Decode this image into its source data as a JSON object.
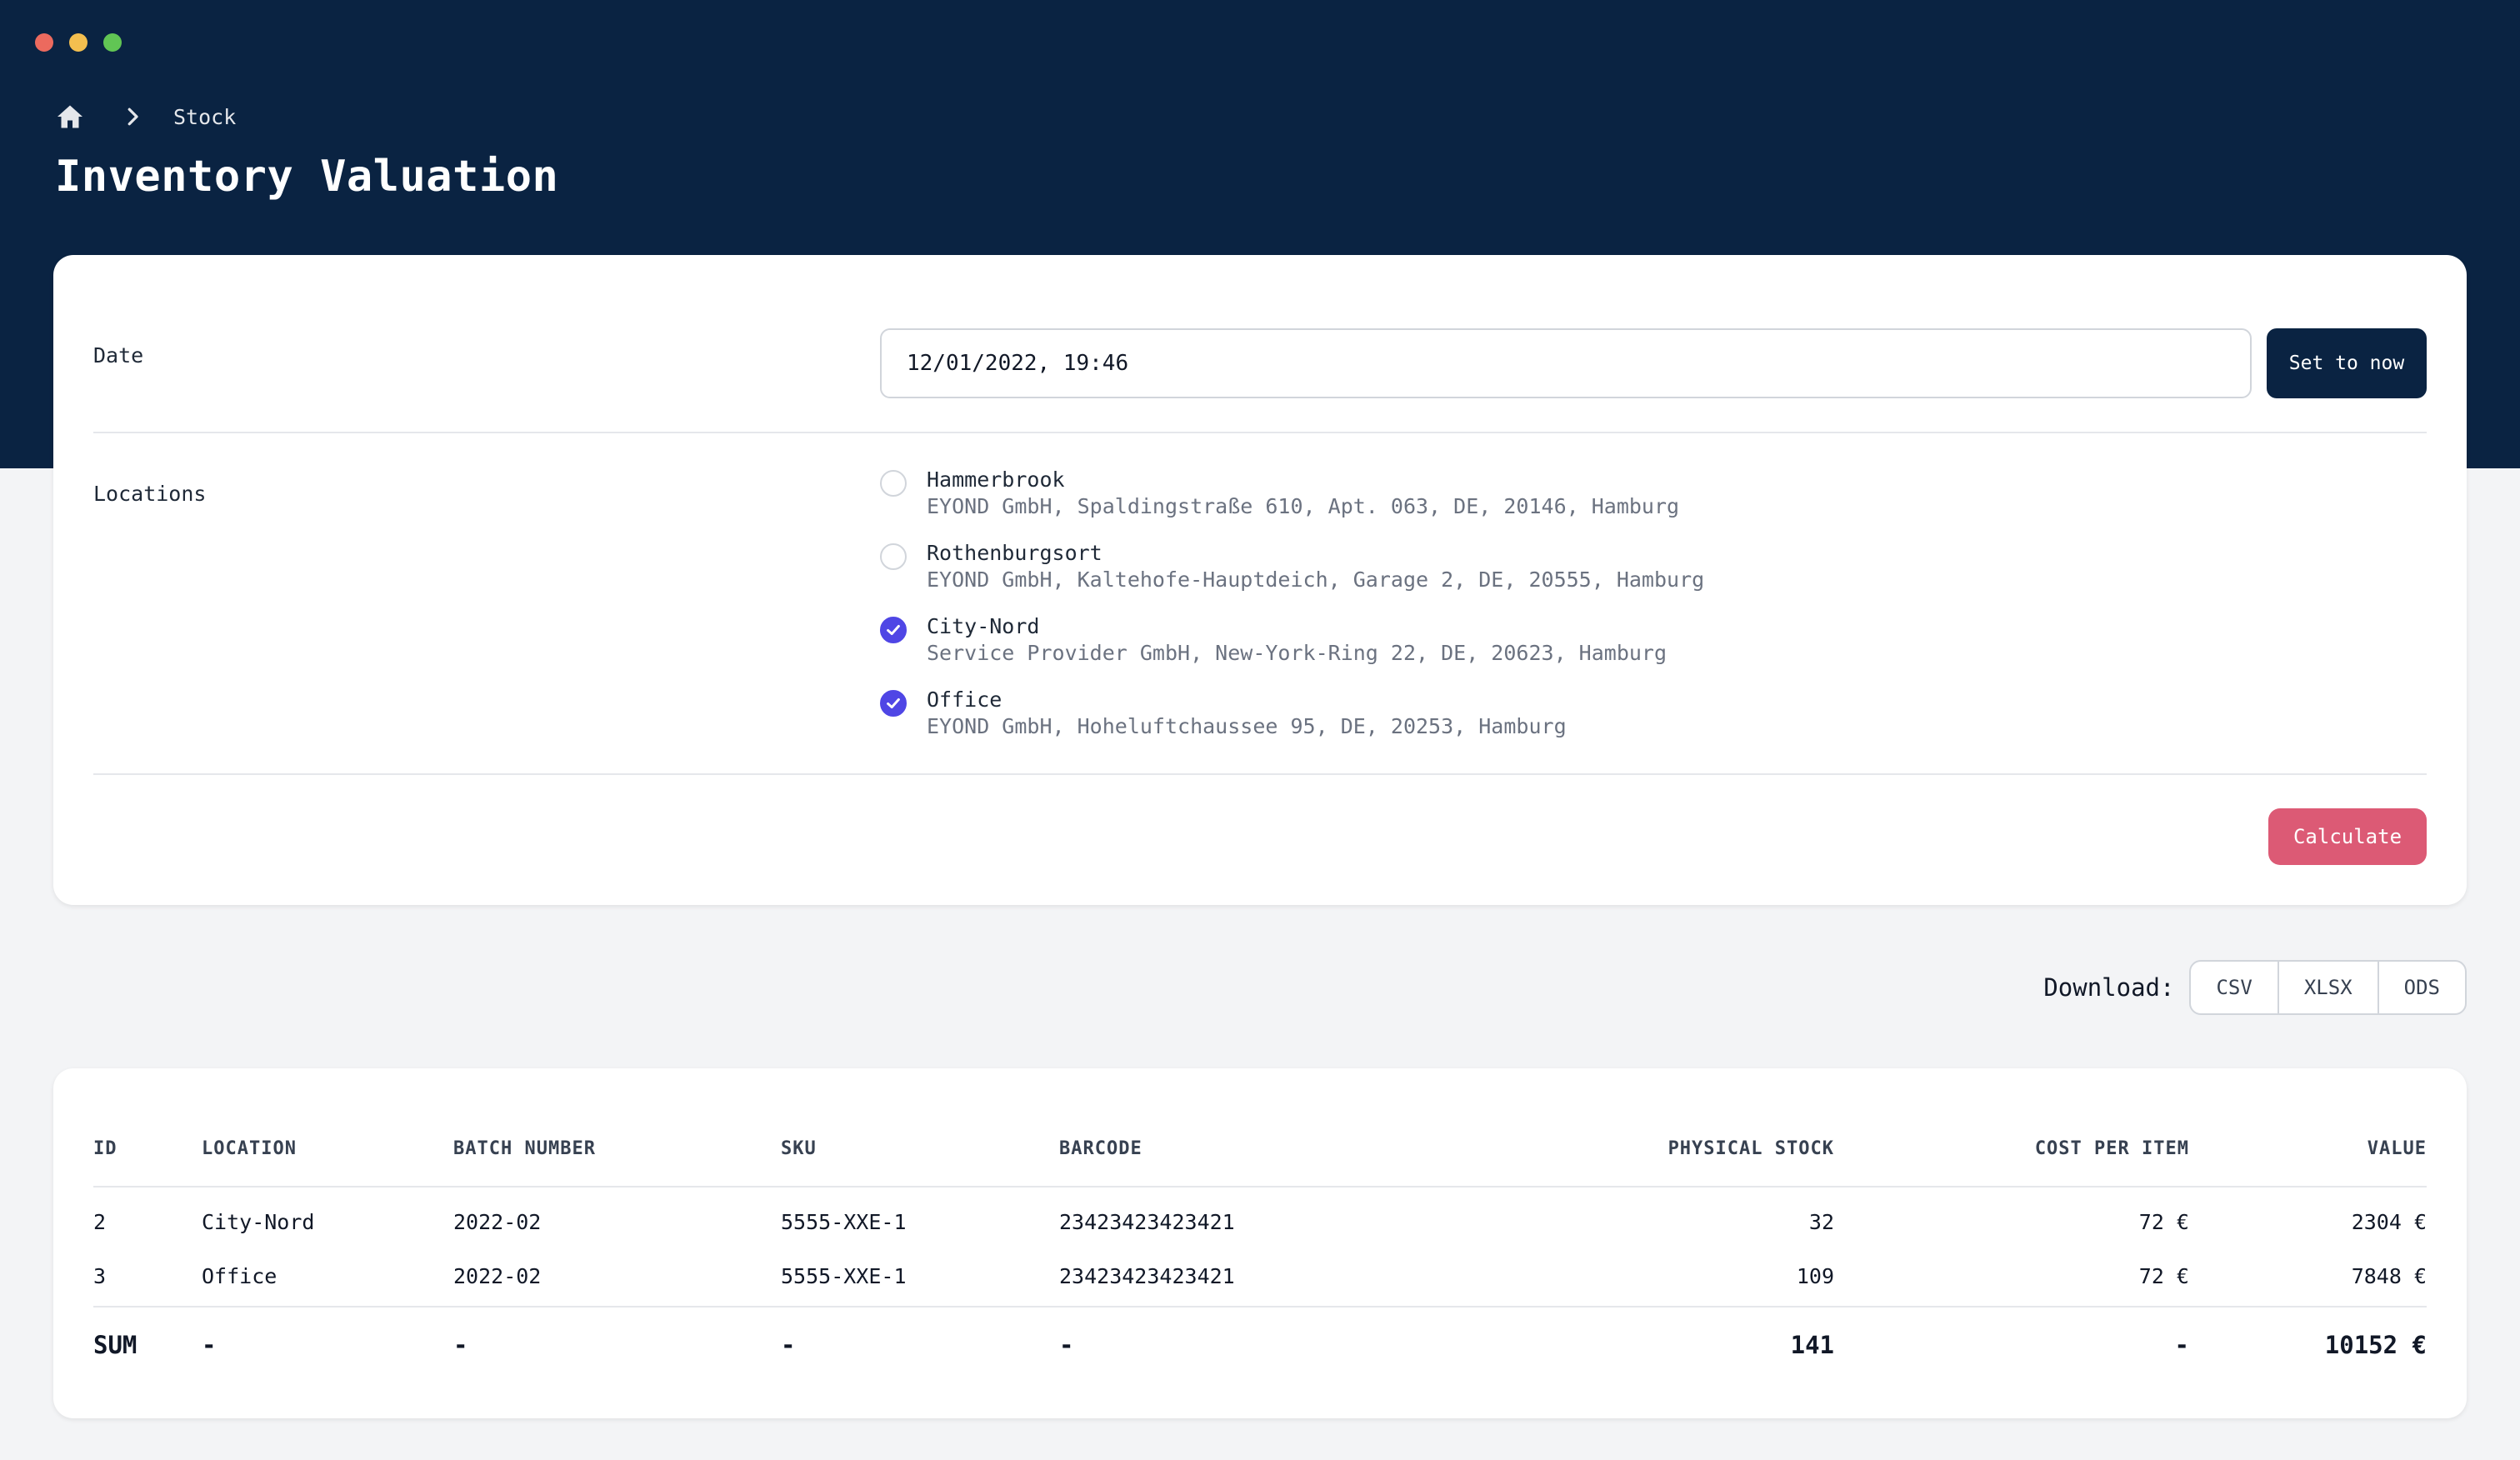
{
  "window": {
    "controls": [
      "close",
      "minimize",
      "maximize"
    ]
  },
  "breadcrumb": {
    "home_icon": "home-icon",
    "separator_icon": "chevron-right-icon",
    "current": "Stock"
  },
  "page": {
    "title": "Inventory Valuation"
  },
  "form": {
    "date": {
      "label": "Date",
      "value": "12/01/2022, 19:46",
      "set_now_label": "Set to now"
    },
    "locations": {
      "label": "Locations",
      "items": [
        {
          "name": "Hammerbrook",
          "address": "EYOND GmbH, Spaldingstraße 610, Apt. 063, DE, 20146, Hamburg",
          "checked": false
        },
        {
          "name": "Rothenburgsort",
          "address": "EYOND GmbH, Kaltehofe-Hauptdeich, Garage 2, DE, 20555, Hamburg",
          "checked": false
        },
        {
          "name": "City-Nord",
          "address": "Service Provider GmbH, New-York-Ring 22, DE, 20623, Hamburg",
          "checked": true
        },
        {
          "name": "Office",
          "address": "EYOND GmbH, Hoheluftchaussee 95, DE, 20253, Hamburg",
          "checked": true
        }
      ]
    },
    "calculate_label": "Calculate"
  },
  "download": {
    "label": "Download:",
    "formats": [
      "CSV",
      "XLSX",
      "ODS"
    ]
  },
  "table": {
    "headers": [
      "ID",
      "LOCATION",
      "BATCH NUMBER",
      "SKU",
      "BARCODE",
      "PHYSICAL STOCK",
      "COST PER ITEM",
      "VALUE"
    ],
    "rows": [
      [
        "2",
        "City-Nord",
        "2022-02",
        "5555-XXE-1",
        "23423423423421",
        "32",
        "72 €",
        "2304 €"
      ],
      [
        "3",
        "Office",
        "2022-02",
        "5555-XXE-1",
        "23423423423421",
        "109",
        "72 €",
        "7848 €"
      ]
    ],
    "sum": [
      "SUM",
      "-",
      "-",
      "-",
      "-",
      "141",
      "-",
      "10152 €"
    ]
  },
  "colors": {
    "header_bg": "#0a2342",
    "page_bg": "#f3f4f6",
    "checkbox_checked": "#4f46e5",
    "calculate_button": "#dc5a75"
  }
}
